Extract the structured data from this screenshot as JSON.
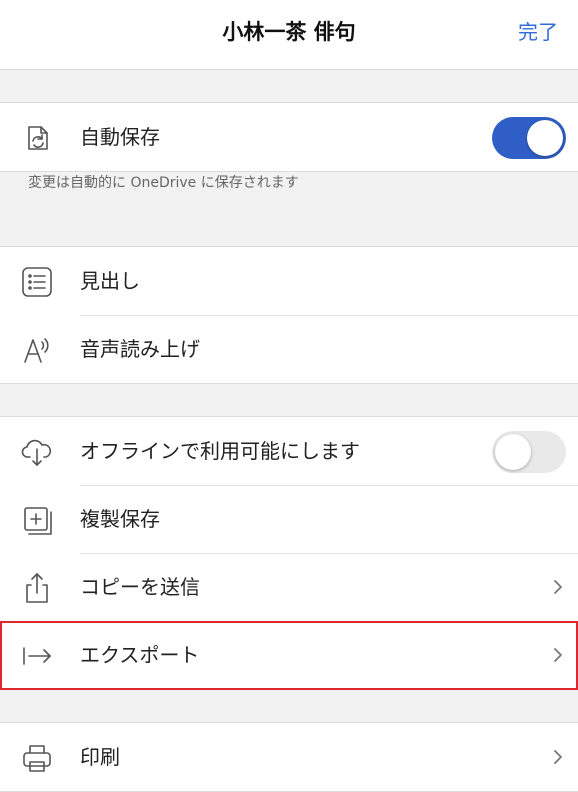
{
  "header": {
    "title": "小林一茶 俳句",
    "done_label": "完了"
  },
  "autosave": {
    "label": "自動保存",
    "enabled": true,
    "note": "変更は自動的に OneDrive に保存されます"
  },
  "view_group": {
    "items": [
      {
        "label": "見出し",
        "icon": "list-icon"
      },
      {
        "label": "音声読み上げ",
        "icon": "read-aloud-icon"
      }
    ]
  },
  "file_group": {
    "offline": {
      "label": "オフラインで利用可能にします",
      "enabled": false
    },
    "items": [
      {
        "label": "複製保存",
        "icon": "duplicate-icon"
      },
      {
        "label": "コピーを送信",
        "icon": "share-icon"
      },
      {
        "label": "エクスポート",
        "icon": "export-icon"
      }
    ]
  },
  "print_group": {
    "items": [
      {
        "label": "印刷",
        "icon": "printer-icon"
      }
    ]
  },
  "colors": {
    "accent": "#2f6cd8",
    "toggle_on": "#2f5fc6",
    "highlight": "#e0262e"
  }
}
